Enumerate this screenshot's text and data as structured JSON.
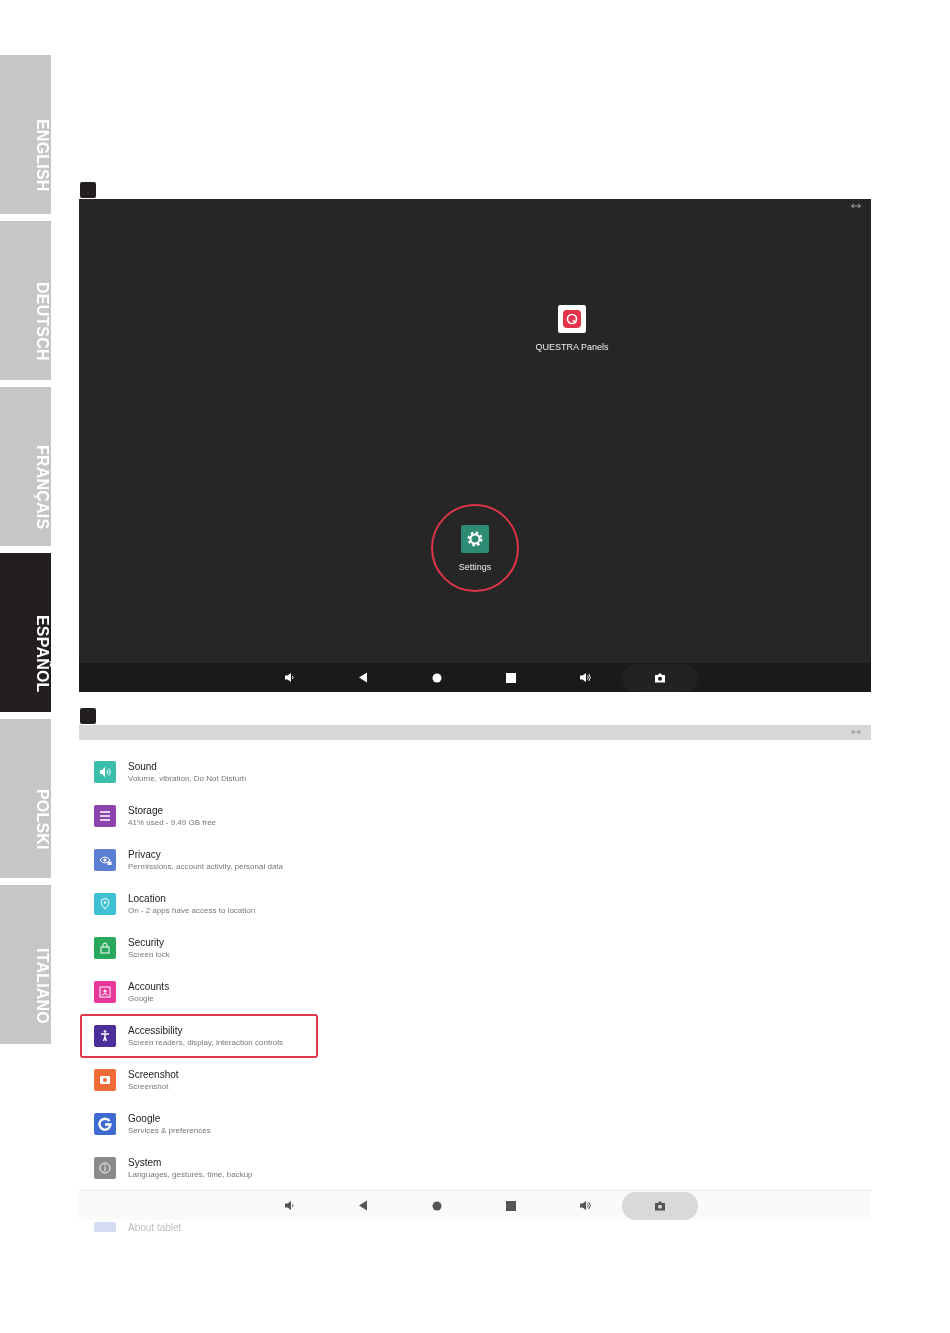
{
  "language_tabs": [
    {
      "label": "ENGLISH",
      "selected": false
    },
    {
      "label": "DEUTSCH",
      "selected": false
    },
    {
      "label": "FRANÇAIS",
      "selected": false
    },
    {
      "label": "ESPAÑOL",
      "selected": true
    },
    {
      "label": "POLSKI",
      "selected": false
    },
    {
      "label": "ITALIANO",
      "selected": false
    }
  ],
  "home_screen": {
    "apps": [
      {
        "kind": "questra",
        "label": "QUESTRA Panels",
        "highlighted": false
      },
      {
        "kind": "settings",
        "label": "Settings",
        "highlighted": true
      }
    ]
  },
  "settings_screen": {
    "items": [
      {
        "kind": "sound",
        "title": "Sound",
        "subtitle": "Volume, vibration, Do Not Disturb",
        "color": "#3bbfad",
        "highlighted": false
      },
      {
        "kind": "storage",
        "title": "Storage",
        "subtitle": "41% used - 9.49 GB free",
        "color": "#8e44ad",
        "highlighted": false
      },
      {
        "kind": "privacy",
        "title": "Privacy",
        "subtitle": "Permissions, account activity, personal data",
        "color": "#5b7fd4",
        "highlighted": false
      },
      {
        "kind": "location",
        "title": "Location",
        "subtitle": "On - 2 apps have access to location",
        "color": "#3fc1d4",
        "highlighted": false
      },
      {
        "kind": "security",
        "title": "Security",
        "subtitle": "Screen lock",
        "color": "#27a85a",
        "highlighted": false
      },
      {
        "kind": "accounts",
        "title": "Accounts",
        "subtitle": "Google",
        "color": "#e8379a",
        "highlighted": false
      },
      {
        "kind": "accessibility",
        "title": "Accessibility",
        "subtitle": "Screen readers, display, interaction controls",
        "color": "#4b2e9a",
        "highlighted": true
      },
      {
        "kind": "screenshot",
        "title": "Screenshot",
        "subtitle": "Screenshot",
        "color": "#f26a35",
        "highlighted": false
      },
      {
        "kind": "google",
        "title": "Google",
        "subtitle": "Services & preferences",
        "color": "#3d6bd1",
        "highlighted": false
      },
      {
        "kind": "system",
        "title": "System",
        "subtitle": "Languages, gestures, time, backup",
        "color": "#8a8a8a",
        "highlighted": false
      }
    ],
    "partial_item": {
      "title": "About tablet"
    }
  }
}
